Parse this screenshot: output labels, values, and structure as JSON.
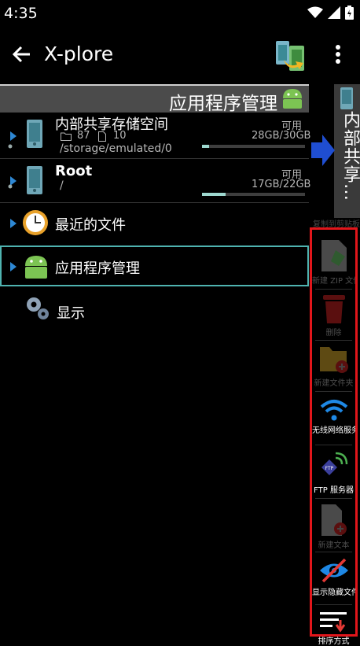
{
  "status": {
    "time": "4:35"
  },
  "appbar": {
    "title": "X-plore"
  },
  "pane": {
    "header": "应用程序管理"
  },
  "rows": [
    {
      "name": "内部共享存储空间",
      "folders": "87",
      "files": "10",
      "path": "/storage/emulated/0",
      "free_label": "可用",
      "space": "28GB/30GB",
      "usage": 0.07
    },
    {
      "name": "Root",
      "path": "/",
      "free_label": "可用",
      "space": "17GB/22GB",
      "usage": 0.23
    },
    {
      "name": "最近的文件"
    },
    {
      "name": "应用程序管理"
    },
    {
      "name": "显示"
    }
  ],
  "side_tab": {
    "label": "内部共享…"
  },
  "toolbar": {
    "copy_label": "复制到剪贴板",
    "items": [
      {
        "label": "新建 ZIP 文件",
        "enabled": false
      },
      {
        "label": "删除",
        "enabled": false
      },
      {
        "label": "新建文件夹",
        "enabled": false
      },
      {
        "label": "无线网络服务",
        "enabled": true
      },
      {
        "label": "FTP 服务器",
        "enabled": true
      },
      {
        "label": "新建文本",
        "enabled": false
      },
      {
        "label": "显示隐藏文件",
        "enabled": true
      },
      {
        "label": "排序方式",
        "enabled": true
      }
    ]
  },
  "colors": {
    "accent": "#4fb3b0",
    "highlight": "#e1161b",
    "android": "#7cc453",
    "bar": "#9ed8cf"
  }
}
